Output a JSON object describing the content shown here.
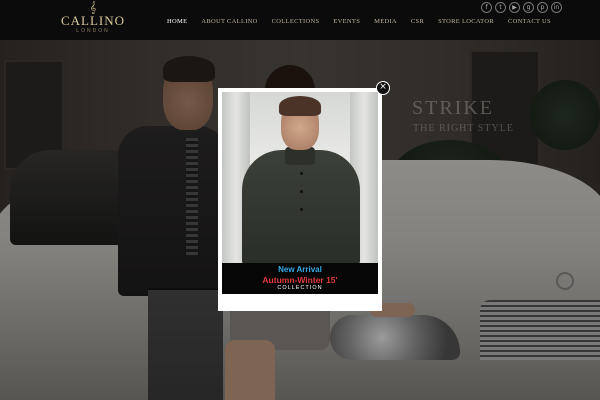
{
  "header": {
    "logo": {
      "text": "CALLINO",
      "subtext": "LONDON",
      "mark": "𝄞"
    },
    "nav": [
      {
        "label": "HOME",
        "active": true
      },
      {
        "label": "ABOUT CALLINO",
        "active": false
      },
      {
        "label": "COLLECTIONS",
        "active": false
      },
      {
        "label": "EVENTS",
        "active": false
      },
      {
        "label": "MEDIA",
        "active": false
      },
      {
        "label": "CSR",
        "active": false
      },
      {
        "label": "STORE LOCATOR",
        "active": false
      },
      {
        "label": "CONTACT US",
        "active": false
      }
    ],
    "social": [
      {
        "icon": "facebook-icon",
        "glyph": "f"
      },
      {
        "icon": "twitter-icon",
        "glyph": "t"
      },
      {
        "icon": "youtube-icon",
        "glyph": "▶"
      },
      {
        "icon": "google-plus-icon",
        "glyph": "g"
      },
      {
        "icon": "pinterest-icon",
        "glyph": "p"
      },
      {
        "icon": "linkedin-icon",
        "glyph": "in"
      }
    ]
  },
  "hero": {
    "headline": "STRIKE",
    "tagline": "THE RIGHT STYLE"
  },
  "popup": {
    "close_glyph": "×",
    "new_arrival": "New Arrival",
    "season": "Autumn-Winter 15'",
    "collection": "COLLECTION"
  },
  "colors": {
    "header_bg": "#0b0b0b",
    "logo_gold": "#c9b98d",
    "new_arrival_blue": "#39a9e6",
    "season_red": "#e23a3a"
  }
}
